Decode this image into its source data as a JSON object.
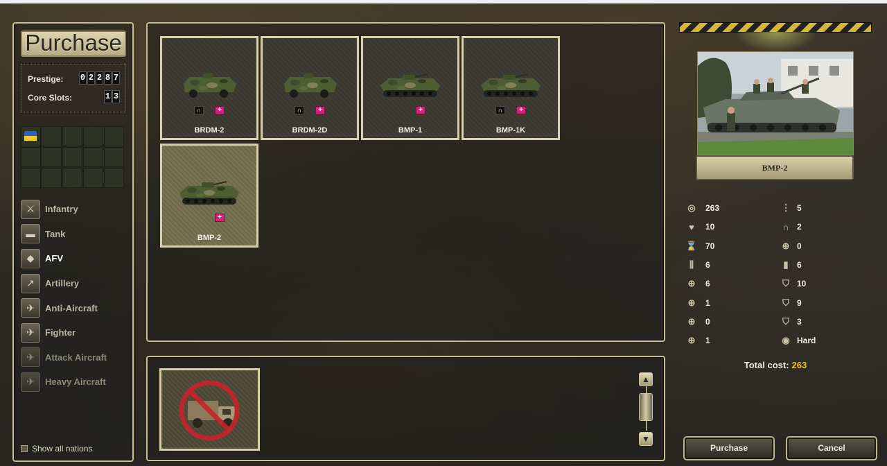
{
  "title": "Purchase",
  "prestige": {
    "label": "Prestige:",
    "digits": [
      "0",
      "2",
      "2",
      "8",
      "7"
    ]
  },
  "core_slots": {
    "label": "Core Slots:",
    "digits": [
      "1",
      "3"
    ]
  },
  "categories": [
    {
      "label": "Infantry",
      "icon": "infantry-icon",
      "state": "normal"
    },
    {
      "label": "Tank",
      "icon": "tank-icon",
      "state": "normal"
    },
    {
      "label": "AFV",
      "icon": "afv-icon",
      "state": "active"
    },
    {
      "label": "Artillery",
      "icon": "artillery-icon",
      "state": "normal"
    },
    {
      "label": "Anti-Aircraft",
      "icon": "anti-aircraft-icon",
      "state": "normal"
    },
    {
      "label": "Fighter",
      "icon": "fighter-icon",
      "state": "normal"
    },
    {
      "label": "Attack Aircraft",
      "icon": "attack-aircraft-icon",
      "state": "dim"
    },
    {
      "label": "Heavy Aircraft",
      "icon": "heavy-aircraft-icon",
      "state": "dim"
    }
  ],
  "show_all_nations": "Show all nations",
  "units": [
    {
      "name": "BRDM-2",
      "recon": true,
      "medic": true,
      "selected": false,
      "type": "wheeled"
    },
    {
      "name": "BRDM-2D",
      "recon": true,
      "medic": true,
      "selected": false,
      "type": "wheeled"
    },
    {
      "name": "BMP-1",
      "recon": false,
      "medic": true,
      "selected": false,
      "type": "tracked"
    },
    {
      "name": "BMP-1K",
      "recon": true,
      "medic": true,
      "selected": false,
      "type": "tracked"
    },
    {
      "name": "BMP-2",
      "recon": false,
      "medic": true,
      "selected": true,
      "type": "tracked"
    }
  ],
  "selected_unit": {
    "name": "BMP-2",
    "stats_left": [
      {
        "icon": "coins-icon",
        "value": "263"
      },
      {
        "icon": "heart-icon",
        "value": "10"
      },
      {
        "icon": "hourglass-icon",
        "value": "70"
      },
      {
        "icon": "ammo-icon",
        "value": "6"
      },
      {
        "icon": "soft-attack-icon",
        "value": "6"
      },
      {
        "icon": "hard-attack-icon",
        "value": "1"
      },
      {
        "icon": "air-attack-icon",
        "value": "0"
      },
      {
        "icon": "naval-attack-icon",
        "value": "1"
      }
    ],
    "stats_right": [
      {
        "icon": "movement-icon",
        "value": "5"
      },
      {
        "icon": "binoculars-icon",
        "value": "2"
      },
      {
        "icon": "crosshair-icon",
        "value": "0"
      },
      {
        "icon": "fuel-icon",
        "value": "6"
      },
      {
        "icon": "ground-defense-icon",
        "value": "10"
      },
      {
        "icon": "air-defense-icon",
        "value": "9"
      },
      {
        "icon": "close-defense-icon",
        "value": "3"
      },
      {
        "icon": "target-type-icon",
        "value": "Hard"
      }
    ],
    "total_cost_label": "Total cost:",
    "total_cost": "263"
  },
  "buttons": {
    "purchase": "Purchase",
    "cancel": "Cancel"
  },
  "colors": {
    "accent_gold": "#f1c233",
    "medic_tag": "#d4207a",
    "frame": "#d9cfab"
  }
}
